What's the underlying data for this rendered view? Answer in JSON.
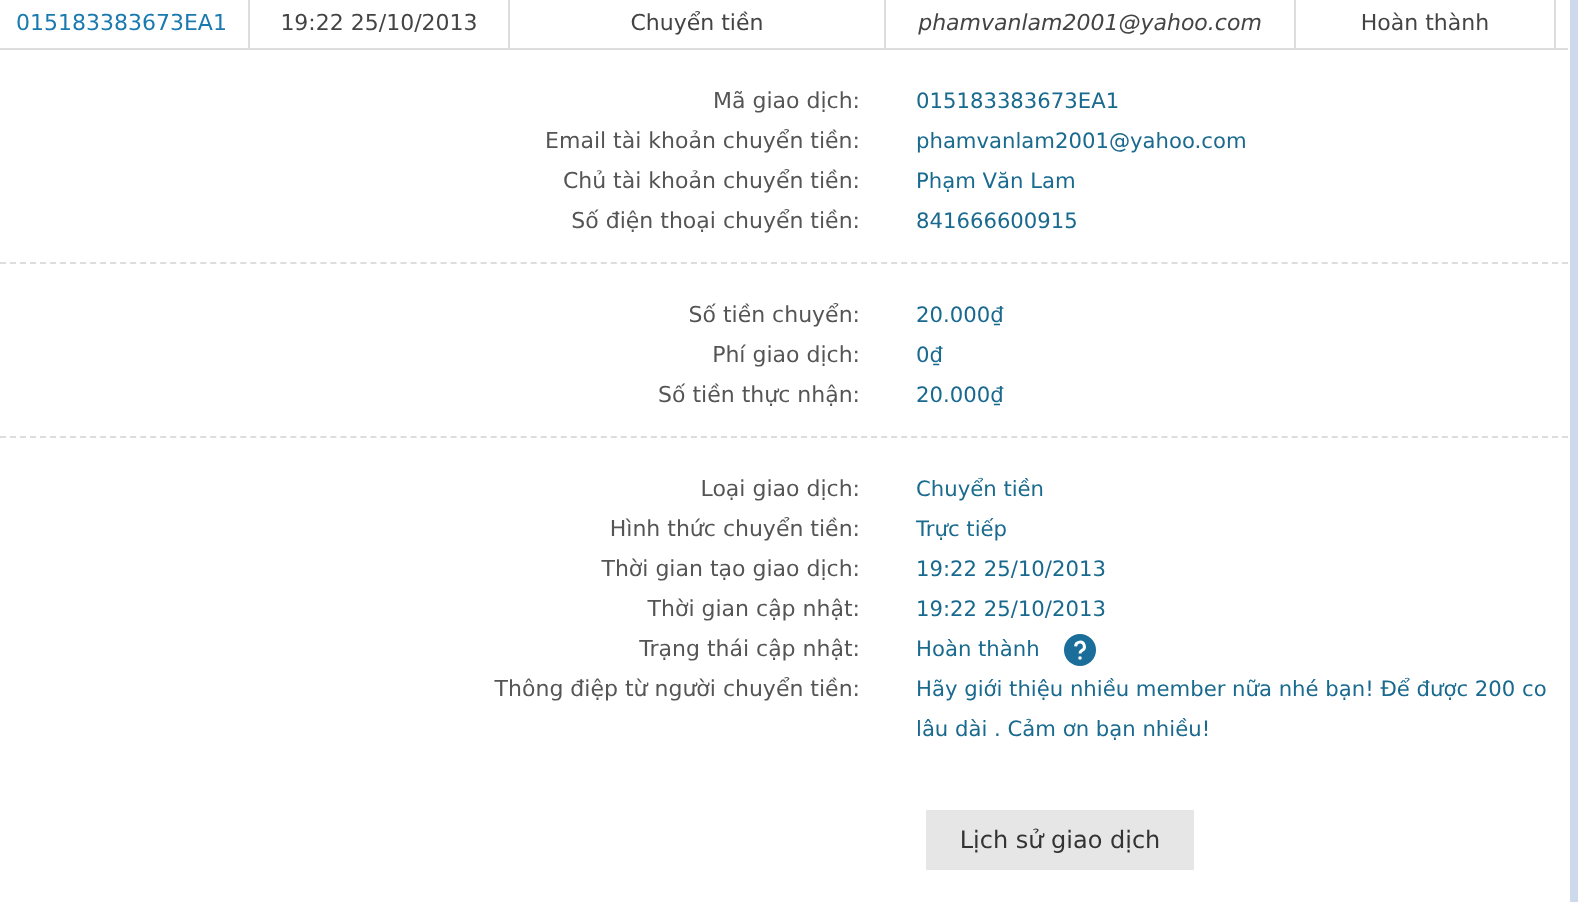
{
  "table_row": {
    "cells": [
      {
        "text": "015183383673EA1",
        "kind": "link"
      },
      {
        "text": "19:22 25/10/2013",
        "kind": "plain"
      },
      {
        "text": "Chuyển tiền",
        "kind": "plain"
      },
      {
        "text": "phamvanlam2001@yahoo.com",
        "kind": "email"
      },
      {
        "text": "Hoàn thành",
        "kind": "plain"
      }
    ]
  },
  "sections": [
    {
      "rows": [
        {
          "label": "Mã giao dịch:",
          "value": [
            "015183383673EA1"
          ]
        },
        {
          "label": "Email tài khoản chuyển tiền:",
          "value": [
            "phamvanlam2001@yahoo.com"
          ]
        },
        {
          "label": "Chủ tài khoản chuyển tiền:",
          "value": [
            "Phạm Văn Lam"
          ]
        },
        {
          "label": "Số điện thoại chuyển tiền:",
          "value": [
            "841666600915"
          ]
        }
      ]
    },
    {
      "rows": [
        {
          "label": "Số tiền chuyển:",
          "value": [
            "20.000₫"
          ]
        },
        {
          "label": "Phí giao dịch:",
          "value": [
            "0₫"
          ]
        },
        {
          "label": "Số tiền thực nhận:",
          "value": [
            "20.000₫"
          ]
        }
      ]
    },
    {
      "rows": [
        {
          "label": "Loại giao dịch:",
          "value": [
            "Chuyển tiền"
          ]
        },
        {
          "label": "Hình thức chuyển tiền:",
          "value": [
            "Trực tiếp"
          ]
        },
        {
          "label": "Thời gian tạo giao dịch:",
          "value": [
            "19:22 25/10/2013"
          ]
        },
        {
          "label": "Thời gian cập nhật:",
          "value": [
            "19:22 25/10/2013"
          ]
        },
        {
          "label": "Trạng thái cập nhật:",
          "value": [
            "Hoàn thành"
          ],
          "help": true
        },
        {
          "label": "Thông điệp từ người chuyển tiền:",
          "value": [
            "Hãy giới thiệu nhiều member nữa nhé bạn! Để được 200 co",
            "lâu dài . Cảm ơn bạn nhiều!"
          ]
        }
      ]
    }
  ],
  "button": "Lịch sử giao dịch"
}
